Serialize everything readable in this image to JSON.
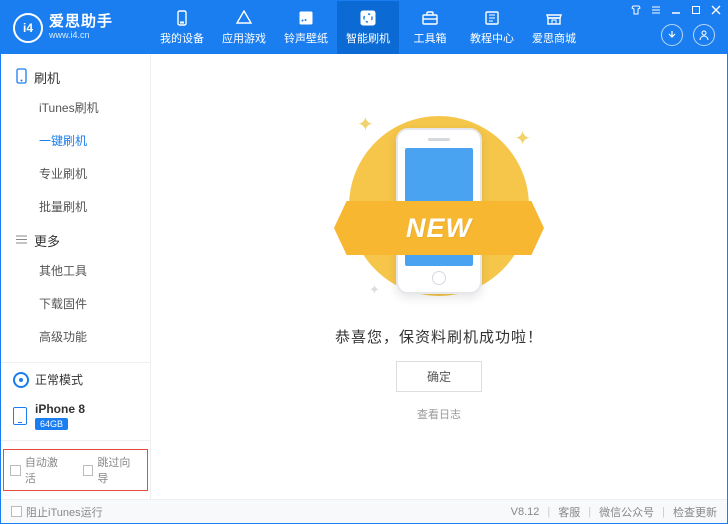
{
  "header": {
    "logo_badge": "i4",
    "logo_title": "爱思助手",
    "logo_sub": "www.i4.cn",
    "nav": [
      {
        "label": "我的设备",
        "icon": "device"
      },
      {
        "label": "应用游戏",
        "icon": "apps"
      },
      {
        "label": "铃声壁纸",
        "icon": "music"
      },
      {
        "label": "智能刷机",
        "icon": "refresh",
        "active": true
      },
      {
        "label": "工具箱",
        "icon": "toolbox"
      },
      {
        "label": "教程中心",
        "icon": "book"
      },
      {
        "label": "爱思商城",
        "icon": "store"
      }
    ],
    "win_controls": [
      "shirt",
      "menu",
      "min",
      "max",
      "close"
    ]
  },
  "sidebar": {
    "groups": [
      {
        "title": "刷机",
        "icon": "phone-flash",
        "items": [
          {
            "label": "iTunes刷机"
          },
          {
            "label": "一键刷机",
            "active": true
          },
          {
            "label": "专业刷机"
          },
          {
            "label": "批量刷机"
          }
        ]
      },
      {
        "title": "更多",
        "icon": "more",
        "items": [
          {
            "label": "其他工具"
          },
          {
            "label": "下载固件"
          },
          {
            "label": "高级功能"
          }
        ]
      }
    ],
    "mode": "正常模式",
    "device": {
      "name": "iPhone 8",
      "capacity": "64GB"
    },
    "bottom_checks": [
      {
        "label": "自动激活"
      },
      {
        "label": "跳过向导"
      }
    ]
  },
  "main": {
    "ribbon": "NEW",
    "success_text": "恭喜您，保资料刷机成功啦！",
    "ok_button": "确定",
    "log_link": "查看日志"
  },
  "statusbar": {
    "left_checkbox": "阻止iTunes运行",
    "version": "V8.12",
    "items": [
      "客服",
      "微信公众号",
      "检查更新"
    ]
  }
}
